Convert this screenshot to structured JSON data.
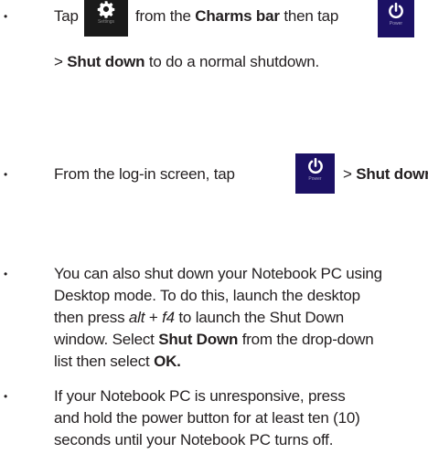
{
  "bullet_symbol": "•",
  "items": [
    {
      "lines": [
        {
          "t1": "Tap",
          "t2": "from the",
          "b1": "Charms bar",
          "t3": "then tap"
        },
        {
          "t1": ">",
          "b1": "Shut down",
          "t2": "to do a normal shutdown."
        }
      ]
    },
    {
      "lines": [
        {
          "t1": "From the log-in screen, tap",
          "t2": ">",
          "b1": "Shut down",
          "t3": "."
        }
      ]
    },
    {
      "lines": [
        {
          "t1": "You can also shut down your Notebook PC using"
        },
        {
          "t1": "Desktop mode. To do this, launch the desktop"
        },
        {
          "t1": "then press",
          "i1": "alt",
          "t2": "+",
          "i2": "f4",
          "t3": "to launch the Shut Down"
        },
        {
          "t1": "window. Select",
          "b1": "Shut Down",
          "t2": "from the drop-down"
        },
        {
          "t1": "list then select",
          "b1": "OK."
        }
      ]
    },
    {
      "lines": [
        {
          "t1": "If your Notebook PC is unresponsive, press"
        },
        {
          "t1": "and hold the power button for at least ten (10)"
        },
        {
          "t1": "seconds until your Notebook PC turns off."
        }
      ]
    }
  ],
  "tiles": {
    "settings_caption": "Settings",
    "power_caption": "Power"
  },
  "colors": {
    "text": "#231f20",
    "settings_tile": "#1a1a1a",
    "power_tile": "#1c1165"
  }
}
